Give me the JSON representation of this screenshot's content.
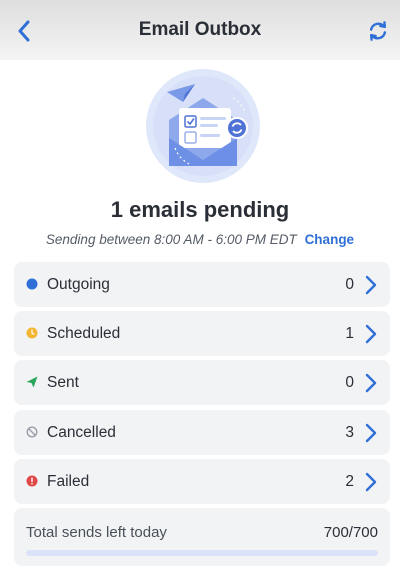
{
  "header": {
    "title": "Email Outbox",
    "back_icon": "chevron-left-icon",
    "refresh_icon": "refresh-icon",
    "accent": "#2f6fd6"
  },
  "hero": {
    "illustration": "envelope-illustration",
    "headline": "1 emails pending",
    "sending_window": "Sending between 8:00 AM - 6:00 PM EDT",
    "change_link": "Change"
  },
  "status_rows": [
    {
      "label": "Outgoing",
      "count": "0",
      "icon": "blue-dot-icon",
      "color": "#2f6fd6"
    },
    {
      "label": "Scheduled",
      "count": "1",
      "icon": "clock-icon",
      "color": "#f2b632"
    },
    {
      "label": "Sent",
      "count": "0",
      "icon": "paper-plane-icon",
      "color": "#2aa65c"
    },
    {
      "label": "Cancelled",
      "count": "3",
      "icon": "cancel-circle-icon",
      "color": "#9a9ea6"
    },
    {
      "label": "Failed",
      "count": "2",
      "icon": "alert-icon",
      "color": "#e04848"
    }
  ],
  "daily_limit": {
    "label": "Total sends left today",
    "value": "700/700",
    "fraction_left": 1.0
  }
}
